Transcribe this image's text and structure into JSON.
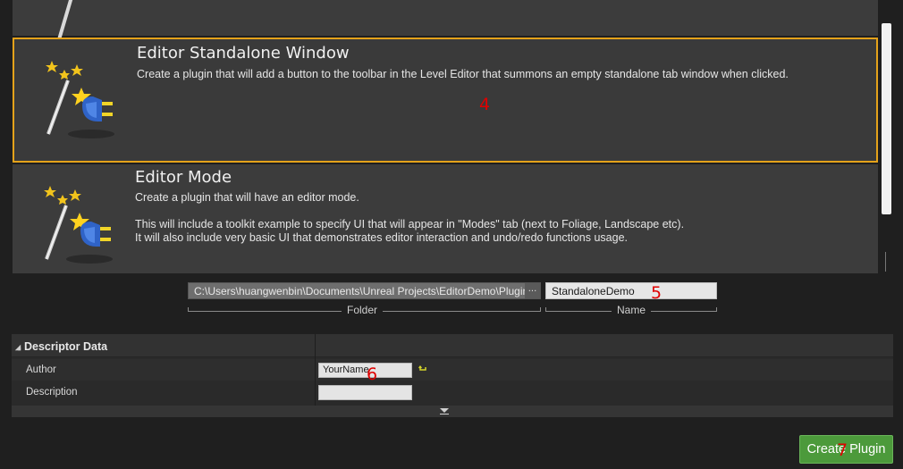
{
  "templates": [
    {
      "title": "Editor Standalone Window",
      "description": "Create a plugin that will add a button to the toolbar in the Level Editor that summons an empty standalone tab window when clicked.",
      "selected": true,
      "icon": "magic-wand-plug-icon"
    },
    {
      "title": "Editor Mode",
      "description_lines": [
        "Create a plugin that will have an editor mode.",
        "This will include a toolkit example to specify UI that will appear in \"Modes\" tab (next to Foliage, Landscape etc).",
        "It will also include very basic UI that demonstrates editor interaction and undo/redo functions usage."
      ],
      "selected": false,
      "icon": "magic-wand-plug-icon"
    }
  ],
  "plugin_location": {
    "folder_value": "C:\\Users\\huangwenbin\\Documents\\Unreal Projects\\EditorDemo\\Plugins",
    "browse_label": "...",
    "folder_caption": "Folder",
    "name_value": "StandaloneDemo",
    "name_caption": "Name"
  },
  "descriptor": {
    "title": "Descriptor Data",
    "properties": [
      {
        "label": "Author",
        "value": "YourName"
      },
      {
        "label": "Description",
        "value": ""
      }
    ]
  },
  "create_button_label": "Create Plugin",
  "annotations": {
    "n4": "4",
    "n5": "5",
    "n6": "6",
    "n7": "7"
  },
  "colors": {
    "selection_border": "#e4a21a",
    "create_button": "#4c9a3b"
  }
}
